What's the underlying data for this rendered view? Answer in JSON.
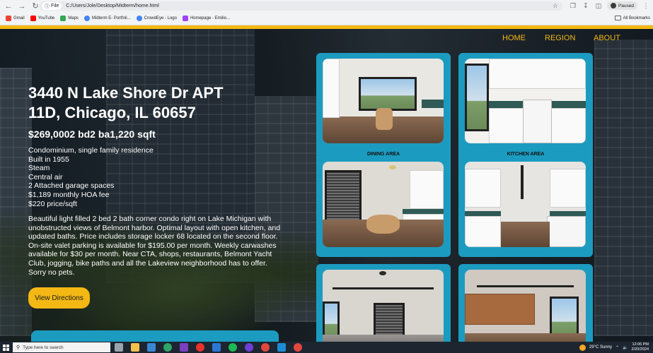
{
  "browser": {
    "url": "C:/Users/Jole/Desktop/Midterm/home.html",
    "scheme_label": "File",
    "profile_status": "Paused",
    "bookmarks": [
      "Gmail",
      "YouTube",
      "Maps",
      "Midterm E- Portfoli...",
      "CrowdEye - Logo",
      "Homepage - Emilio..."
    ],
    "all_bookmarks_label": "All Bookmarks",
    "colors": {
      "gmail": "#ea4335",
      "youtube": "#ff0000",
      "maps": "#34a853",
      "midterm": "#4285f4",
      "crowdeye": "#4285f4",
      "homepage": "#a142f4"
    }
  },
  "nav": {
    "home": "HOME",
    "region": "REGION",
    "about": "ABOUT"
  },
  "listing": {
    "address_line1": "3440 N Lake Shore Dr APT",
    "address_line2": "11D, Chicago, IL 60657",
    "price_line": "$269,0002 bd2 ba1,220 sqft",
    "facts": [
      "Condominium, single family residence",
      "Built in 1955",
      "Steam",
      "Central air",
      "2 Attached garage spaces",
      "$1,189 monthly HOA fee",
      "$220 price/sqft"
    ],
    "description": "Beautiful light filled 2 bed 2 bath corner condo right on Lake Michigan with unobstructed views of Belmont harbor. Optimal layout with open kitchen, and updated baths. Price includes storage locker 68 located on the second floor. On-site valet parking is available for $195.00 per month. Weekly carwashes available for $30 per month. Near CTA, shops, restaurants, Belmont Yacht Club, jogging, bike paths and all the Lakeview neighborhood has to offer. Sorry no pets.",
    "directions_button": "View Directions"
  },
  "gallery": {
    "captions": {
      "dining": "DINING AREA",
      "kitchen": "KITCHEN AREA"
    }
  },
  "theme": {
    "accent": "#f3b814",
    "card": "#1c9bc0"
  },
  "taskbar": {
    "search_placeholder": "Type here to search",
    "weather": "29°C  Sunny",
    "time": "12:06 PM",
    "date": "2/20/2024"
  }
}
